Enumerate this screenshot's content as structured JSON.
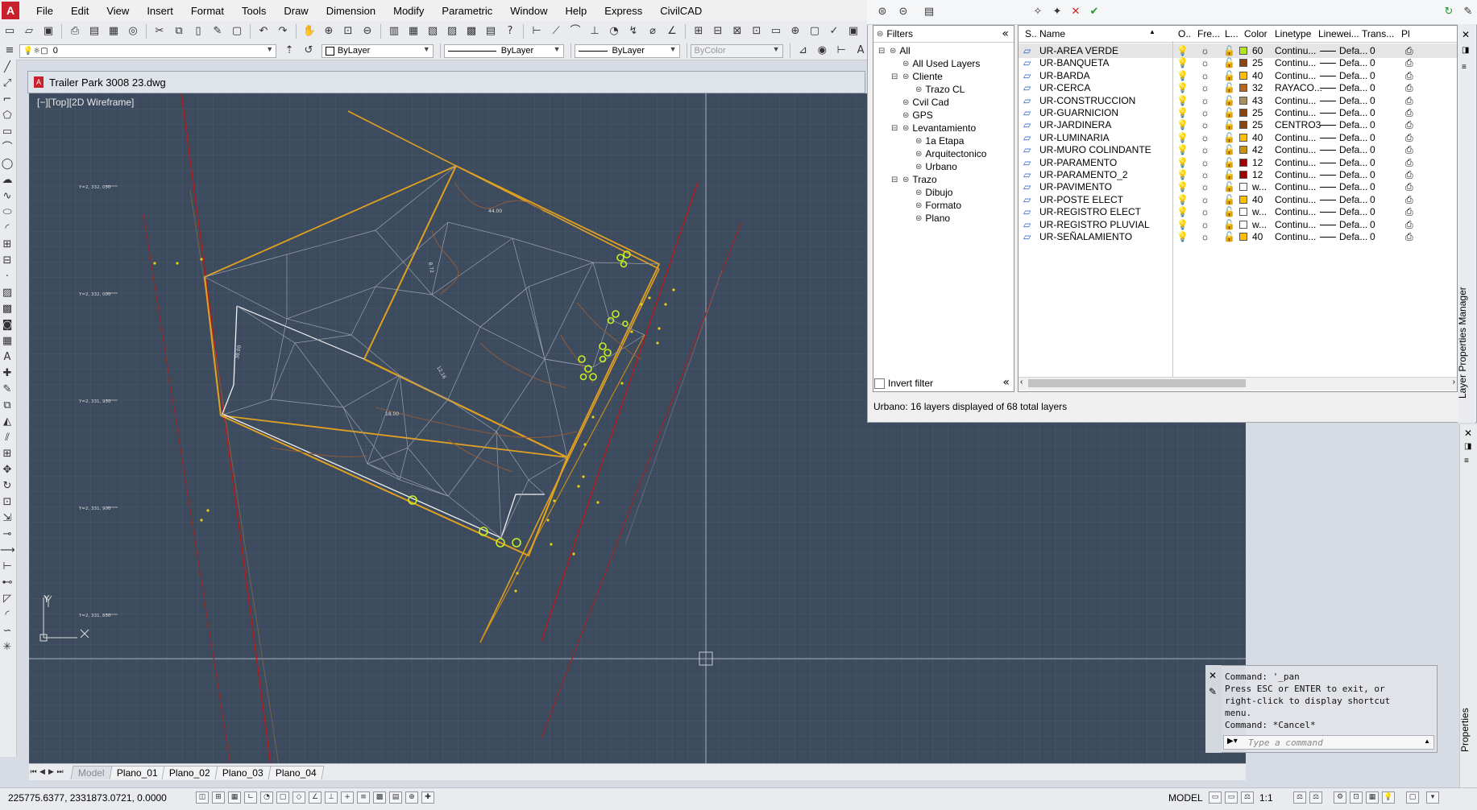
{
  "menubar": {
    "items": [
      "File",
      "Edit",
      "View",
      "Insert",
      "Format",
      "Tools",
      "Draw",
      "Dimension",
      "Modify",
      "Parametric",
      "Window",
      "Help",
      "Express",
      "CivilCAD"
    ]
  },
  "props_toolbar": {
    "layer_value": "0",
    "color_value": "ByLayer",
    "linetype_value": "ByLayer",
    "lineweight_value": "ByLayer",
    "plotstyle_value": "ByColor"
  },
  "document": {
    "title": "Trailer Park 3008 23.dwg",
    "viewport_label": "[−][Top][2D Wireframe]",
    "y_tick_labels": [
      "Y=2, 332, 050",
      "Y=2, 332, 000",
      "Y=2, 331, 950",
      "Y=2, 331, 900",
      "Y=2, 331, 850"
    ]
  },
  "layer_manager": {
    "title": "Layer Properties Manager",
    "filters_header": "Filters",
    "filter_tree": [
      {
        "label": "All",
        "depth": 0,
        "expander": "⊟"
      },
      {
        "label": "All Used Layers",
        "depth": 1,
        "expander": ""
      },
      {
        "label": "Cliente",
        "depth": 1,
        "expander": "⊟"
      },
      {
        "label": "Trazo CL",
        "depth": 2,
        "expander": ""
      },
      {
        "label": "Cvil Cad",
        "depth": 1,
        "expander": ""
      },
      {
        "label": "GPS",
        "depth": 1,
        "expander": ""
      },
      {
        "label": "Levantamiento",
        "depth": 1,
        "expander": "⊟"
      },
      {
        "label": "1a Etapa",
        "depth": 2,
        "expander": ""
      },
      {
        "label": "Arquitectonico",
        "depth": 2,
        "expander": ""
      },
      {
        "label": "Urbano",
        "depth": 2,
        "expander": ""
      },
      {
        "label": "Trazo",
        "depth": 1,
        "expander": "⊟"
      },
      {
        "label": "Dibujo",
        "depth": 2,
        "expander": ""
      },
      {
        "label": "Formato",
        "depth": 2,
        "expander": ""
      },
      {
        "label": "Plano",
        "depth": 2,
        "expander": ""
      }
    ],
    "invert_filter_label": "Invert filter",
    "columns": [
      "S..",
      "Name",
      "O..",
      "Fre...",
      "L...",
      "Color",
      "Linetype",
      "Linewei...",
      "Trans...",
      "Pl"
    ],
    "layers": [
      {
        "name": "UR-AREA VERDE",
        "color": "60",
        "color_hex": "#b5e61d",
        "linetype": "Continu...",
        "lineweight": "Defa...",
        "transparency": "0"
      },
      {
        "name": "UR-BANQUETA",
        "color": "25",
        "color_hex": "#8b4513",
        "linetype": "Continu...",
        "lineweight": "Defa...",
        "transparency": "0"
      },
      {
        "name": "UR-BARDA",
        "color": "40",
        "color_hex": "#ffbf00",
        "linetype": "Continu...",
        "lineweight": "Defa...",
        "transparency": "0"
      },
      {
        "name": "UR-CERCA",
        "color": "32",
        "color_hex": "#b5651d",
        "linetype": "RAYACO...",
        "lineweight": "Defa...",
        "transparency": "0"
      },
      {
        "name": "UR-CONSTRUCCION",
        "color": "43",
        "color_hex": "#a89060",
        "linetype": "Continu...",
        "lineweight": "Defa...",
        "transparency": "0"
      },
      {
        "name": "UR-GUARNICION",
        "color": "25",
        "color_hex": "#8b4513",
        "linetype": "Continu...",
        "lineweight": "Defa...",
        "transparency": "0"
      },
      {
        "name": "UR-JARDINERA",
        "color": "25",
        "color_hex": "#8b4513",
        "linetype": "CENTRO3",
        "lineweight": "Defa...",
        "transparency": "0"
      },
      {
        "name": "UR-LUMINARIA",
        "color": "40",
        "color_hex": "#ffbf00",
        "linetype": "Continu...",
        "lineweight": "Defa...",
        "transparency": "0"
      },
      {
        "name": "UR-MURO COLINDANTE",
        "color": "42",
        "color_hex": "#c8960c",
        "linetype": "Continu...",
        "lineweight": "Defa...",
        "transparency": "0"
      },
      {
        "name": "UR-PARAMENTO",
        "color": "12",
        "color_hex": "#a00000",
        "linetype": "Continu...",
        "lineweight": "Defa...",
        "transparency": "0"
      },
      {
        "name": "UR-PARAMENTO_2",
        "color": "12",
        "color_hex": "#a00000",
        "linetype": "Continu...",
        "lineweight": "Defa...",
        "transparency": "0"
      },
      {
        "name": "UR-PAVIMENTO",
        "color": "w...",
        "color_hex": "#ffffff",
        "linetype": "Continu...",
        "lineweight": "Defa...",
        "transparency": "0"
      },
      {
        "name": "UR-POSTE ELECT",
        "color": "40",
        "color_hex": "#ffbf00",
        "linetype": "Continu...",
        "lineweight": "Defa...",
        "transparency": "0"
      },
      {
        "name": "UR-REGISTRO ELECT",
        "color": "w...",
        "color_hex": "#ffffff",
        "linetype": "Continu...",
        "lineweight": "Defa...",
        "transparency": "0"
      },
      {
        "name": "UR-REGISTRO PLUVIAL",
        "color": "w...",
        "color_hex": "#ffffff",
        "linetype": "Continu...",
        "lineweight": "Defa...",
        "transparency": "0"
      },
      {
        "name": "UR-SEÑALAMIENTO",
        "color": "40",
        "color_hex": "#ffbf00",
        "linetype": "Continu...",
        "lineweight": "Defa...",
        "transparency": "0"
      }
    ],
    "status": "Urbano: 16 layers displayed of 68 total layers"
  },
  "properties_palette": {
    "title": "Properties"
  },
  "command_window": {
    "history": "Command: '_pan\nPress ESC or ENTER to exit, or\nright-click to display shortcut\nmenu.\nCommand: *Cancel*",
    "placeholder": "Type a command"
  },
  "layout_tabs": [
    "Model",
    "Plano_01",
    "Plano_02",
    "Plano_03",
    "Plano_04"
  ],
  "statusbar": {
    "coordinates": "225775.6377, 2331873.0721, 0.0000",
    "space": "MODEL",
    "scale": "1:1"
  },
  "axis_labels": {
    "x": "X",
    "y": "Y"
  },
  "colors": {
    "viewport_bg": "#3d4b5f",
    "boundary": "#e0a020",
    "paramento": "#b01c1c",
    "vegetation": "#c8f020"
  }
}
